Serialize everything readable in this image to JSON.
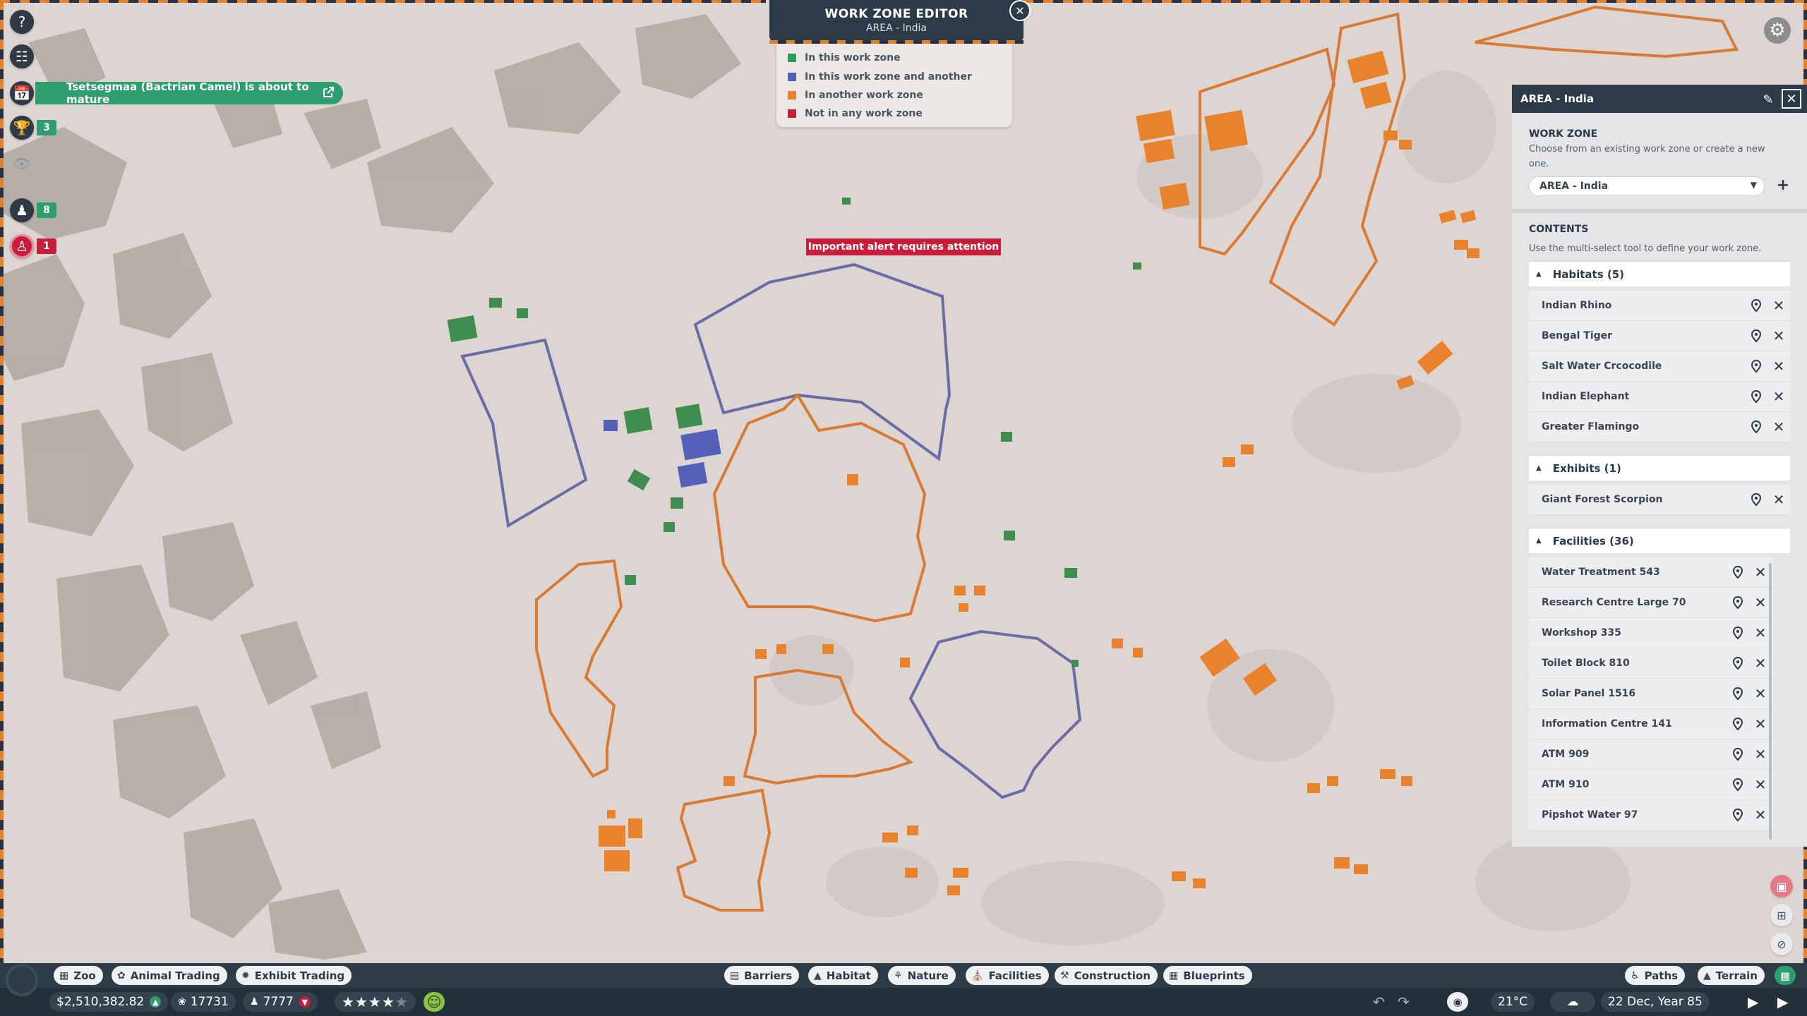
{
  "editor": {
    "title": "WORK ZONE EDITOR",
    "subtitle": "AREA - India",
    "close_icon": "close-icon"
  },
  "legend": [
    {
      "label": "In this work zone",
      "color": "#2e9b5e"
    },
    {
      "label": "In this work zone and another",
      "color": "#5560b8"
    },
    {
      "label": "In another work zone",
      "color": "#e8822c"
    },
    {
      "label": "Not in any work zone",
      "color": "#c81e3c"
    }
  ],
  "alert": "Important alert requires attention",
  "notification": "Tsetsegmaa (Bactrian Camel) is about to mature",
  "left_badges": {
    "trophy": "3",
    "staff": "8",
    "guest_alert": "1"
  },
  "panel": {
    "title": "AREA - India",
    "work_zone_heading": "WORK ZONE",
    "work_zone_desc": "Choose from an existing work zone or create a new one.",
    "selected_zone": "AREA - India",
    "contents_heading": "CONTENTS",
    "contents_desc": "Use the multi-select tool to define your work zone.",
    "habitats_label": "Habitats (5)",
    "habitats": [
      "Indian Rhino",
      "Bengal Tiger",
      "Salt Water Crcocodile",
      "Indian Elephant",
      "Greater Flamingo"
    ],
    "exhibits_label": "Exhibits (1)",
    "exhibits": [
      "Giant Forest Scorpion"
    ],
    "facilities_label": "Facilities (36)",
    "facilities": [
      "Water Treatment 543",
      "Research Centre Large 70",
      "Workshop 335",
      "Toilet Block 810",
      "Solar Panel 1516",
      "Information Centre 141",
      "ATM 909",
      "ATM 910",
      "Pipshot Water 97"
    ]
  },
  "toolbar": {
    "zoo": "Zoo",
    "animal_trading": "Animal Trading",
    "exhibit_trading": "Exhibit Trading",
    "barriers": "Barriers",
    "habitat": "Habitat",
    "nature": "Nature",
    "facilities": "Facilities",
    "construction": "Construction",
    "blueprints": "Blueprints",
    "paths": "Paths",
    "terrain": "Terrain"
  },
  "status": {
    "money": "$2,510,382.82",
    "conservation": "17731",
    "guests": "7777",
    "rating_stars": 4,
    "temperature": "21°C",
    "date": "22 Dec, Year 85"
  },
  "colors": {
    "accent_green": "#2f9e6f",
    "alert_red": "#c81e3c",
    "orange_zone": "#e8822c",
    "blue_zone": "#5560b8",
    "panel_dark": "#2d3a47"
  }
}
